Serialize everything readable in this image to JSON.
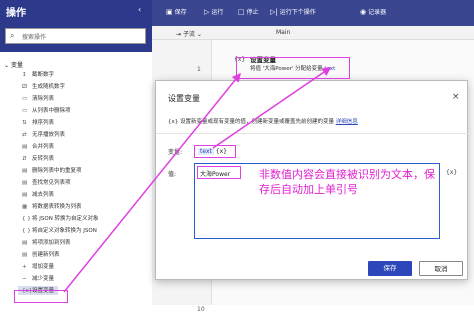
{
  "left_panel": {
    "title": "操作",
    "search_placeholder": "搜索操作",
    "group_label": "变量",
    "items": [
      "截断数字",
      "生成随机数字",
      "清除列表",
      "从列表中删除项",
      "排序列表",
      "无序播放列表",
      "合并列表",
      "反转列表",
      "删除列表中的重复项",
      "查找常见列表项",
      "减去列表",
      "将数据表转换为列表",
      "将 JSON 转换为自定义对象",
      "将自定义对象转换为 JSON",
      "将项添加到列表",
      "创建新列表",
      "增加变量",
      "减少变量",
      "设置变量"
    ]
  },
  "toolbar": {
    "save": "保存",
    "run": "运行",
    "stop": "停止",
    "run_next": "运行下个操作",
    "recorder": "记录器"
  },
  "flow": {
    "subflows_tab": "子流",
    "main_tab": "Main",
    "line_numbers": [
      "1",
      "10"
    ],
    "step_title": "设置变量",
    "step_desc_prefix": "将值 '大海Power' 分配给变量",
    "step_desc_var": "text",
    "step_desc_value": "大海Power"
  },
  "dialog": {
    "title": "设置变量",
    "close_label": "×",
    "description": "设置新变量或现有变量的值，创建新变量或覆盖先前创建的变量",
    "link": "详细信息",
    "variable_label": "变量:",
    "variable_name": "text",
    "variable_icon_text": "{x}",
    "value_label": "值:",
    "value_text": "大海Power",
    "value_icon_text": "{x}",
    "annotation": "非数值内容会直接被识别为文本，保存后自动加上单引号",
    "save_button": "保存",
    "cancel_button": "取消"
  },
  "colors": {
    "panel_header": "#2d3a8c",
    "accent": "#2d46b9",
    "annotation": "#e040e0"
  }
}
